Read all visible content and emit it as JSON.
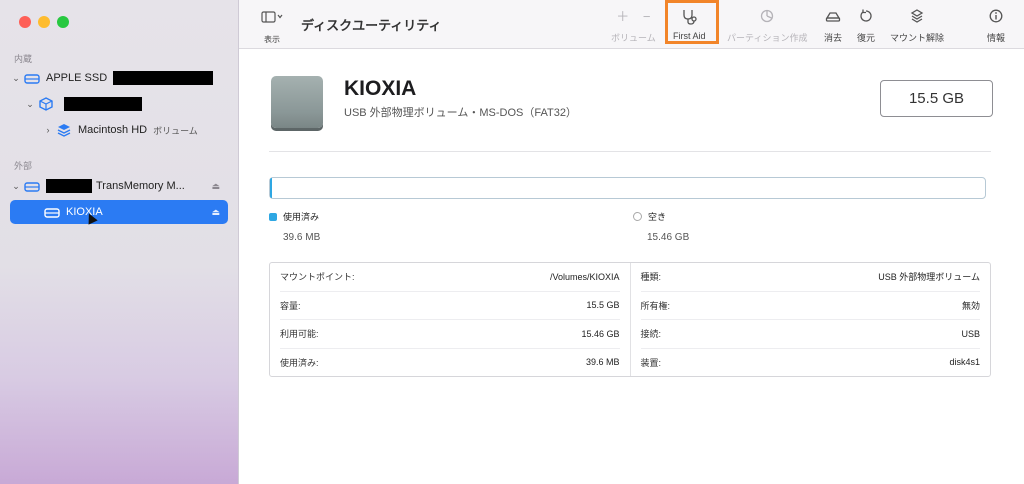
{
  "app": {
    "title": "ディスクユーティリティ",
    "view_label": "表示"
  },
  "toolbar": {
    "volume_label": "ボリューム",
    "first_aid_label": "First Aid",
    "partition_label": "パーティション作成",
    "erase_label": "消去",
    "restore_label": "復元",
    "unmount_label": "マウント解除",
    "info_label": "情報",
    "plus_icon": "＋",
    "minus_icon": "−"
  },
  "sidebar": {
    "internal_label": "内蔵",
    "external_label": "外部",
    "items": [
      {
        "label": "APPLE SSD",
        "icon": "internal-drive-icon"
      },
      {
        "label": "",
        "icon": "container-icon"
      },
      {
        "label": "Macintosh HD",
        "sub": "ボリューム",
        "icon": "volume-stack-icon"
      },
      {
        "label": "TransMemory M...",
        "icon": "external-drive-icon"
      },
      {
        "label": "KIOXIA",
        "icon": "volume-icon"
      }
    ],
    "eject_glyph": "⏏"
  },
  "main": {
    "drive_name": "KIOXIA",
    "drive_subtitle": "USB 外部物理ボリューム・MS-DOS（FAT32）",
    "capacity": "15.5 GB",
    "usage_fraction": 0.0026,
    "used_color": "#2ea7e3",
    "used": {
      "label": "使用済み",
      "value": "39.6 MB"
    },
    "free": {
      "label": "空き",
      "value": "15.46 GB"
    },
    "details_left": [
      {
        "key": "マウントポイント:",
        "value": "/Volumes/KIOXIA"
      },
      {
        "key": "容量:",
        "value": "15.5 GB"
      },
      {
        "key": "利用可能:",
        "value": "15.46 GB"
      },
      {
        "key": "使用済み:",
        "value": "39.6 MB"
      }
    ],
    "details_right": [
      {
        "key": "種類:",
        "value": "USB 外部物理ボリューム"
      },
      {
        "key": "所有権:",
        "value": "無効"
      },
      {
        "key": "接続:",
        "value": "USB"
      },
      {
        "key": "装置:",
        "value": "disk4s1"
      }
    ]
  },
  "colors": {
    "accent": "#2b7bf3",
    "highlight": "#f2852a"
  }
}
